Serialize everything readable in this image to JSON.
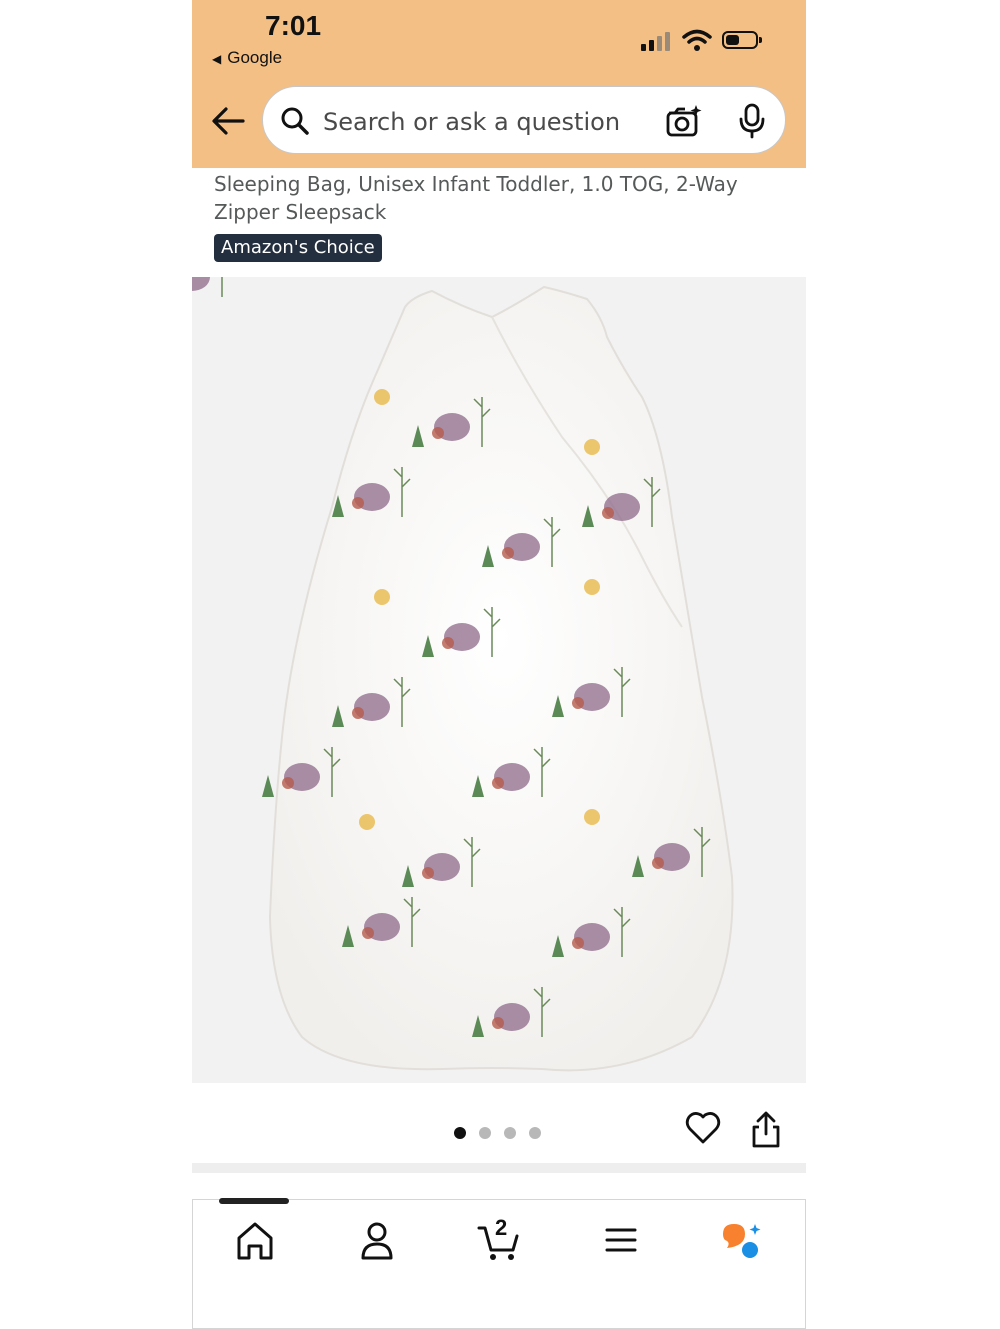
{
  "status_bar": {
    "time": "7:01",
    "back_app_label": "Google",
    "icons": [
      "cellular-signal-icon",
      "wifi-icon",
      "battery-icon"
    ]
  },
  "header": {
    "background_color": "#f4bf85",
    "search": {
      "placeholder": "Search or ask a question"
    },
    "icons": [
      "back-arrow-icon",
      "search-icon",
      "camera-icon",
      "microphone-icon"
    ]
  },
  "product": {
    "title": "Sleeping Bag, Unisex Infant Toddler, 1.0 TOG, 2-Way Zipper Sleepsack",
    "badge": "Amazon's Choice",
    "image_count": 4,
    "active_image": 1
  },
  "actions": {
    "icons": [
      "heart-icon",
      "share-icon"
    ]
  },
  "bottom_nav": {
    "items": [
      {
        "name": "home",
        "icon": "home-icon"
      },
      {
        "name": "account",
        "icon": "person-icon"
      },
      {
        "name": "cart",
        "icon": "cart-icon",
        "count": "2"
      },
      {
        "name": "menu",
        "icon": "menu-icon"
      },
      {
        "name": "rufus",
        "icon": "assistant-icon"
      }
    ],
    "accent_colors": {
      "orange": "#f7812f",
      "blue": "#1a8fe3"
    }
  }
}
